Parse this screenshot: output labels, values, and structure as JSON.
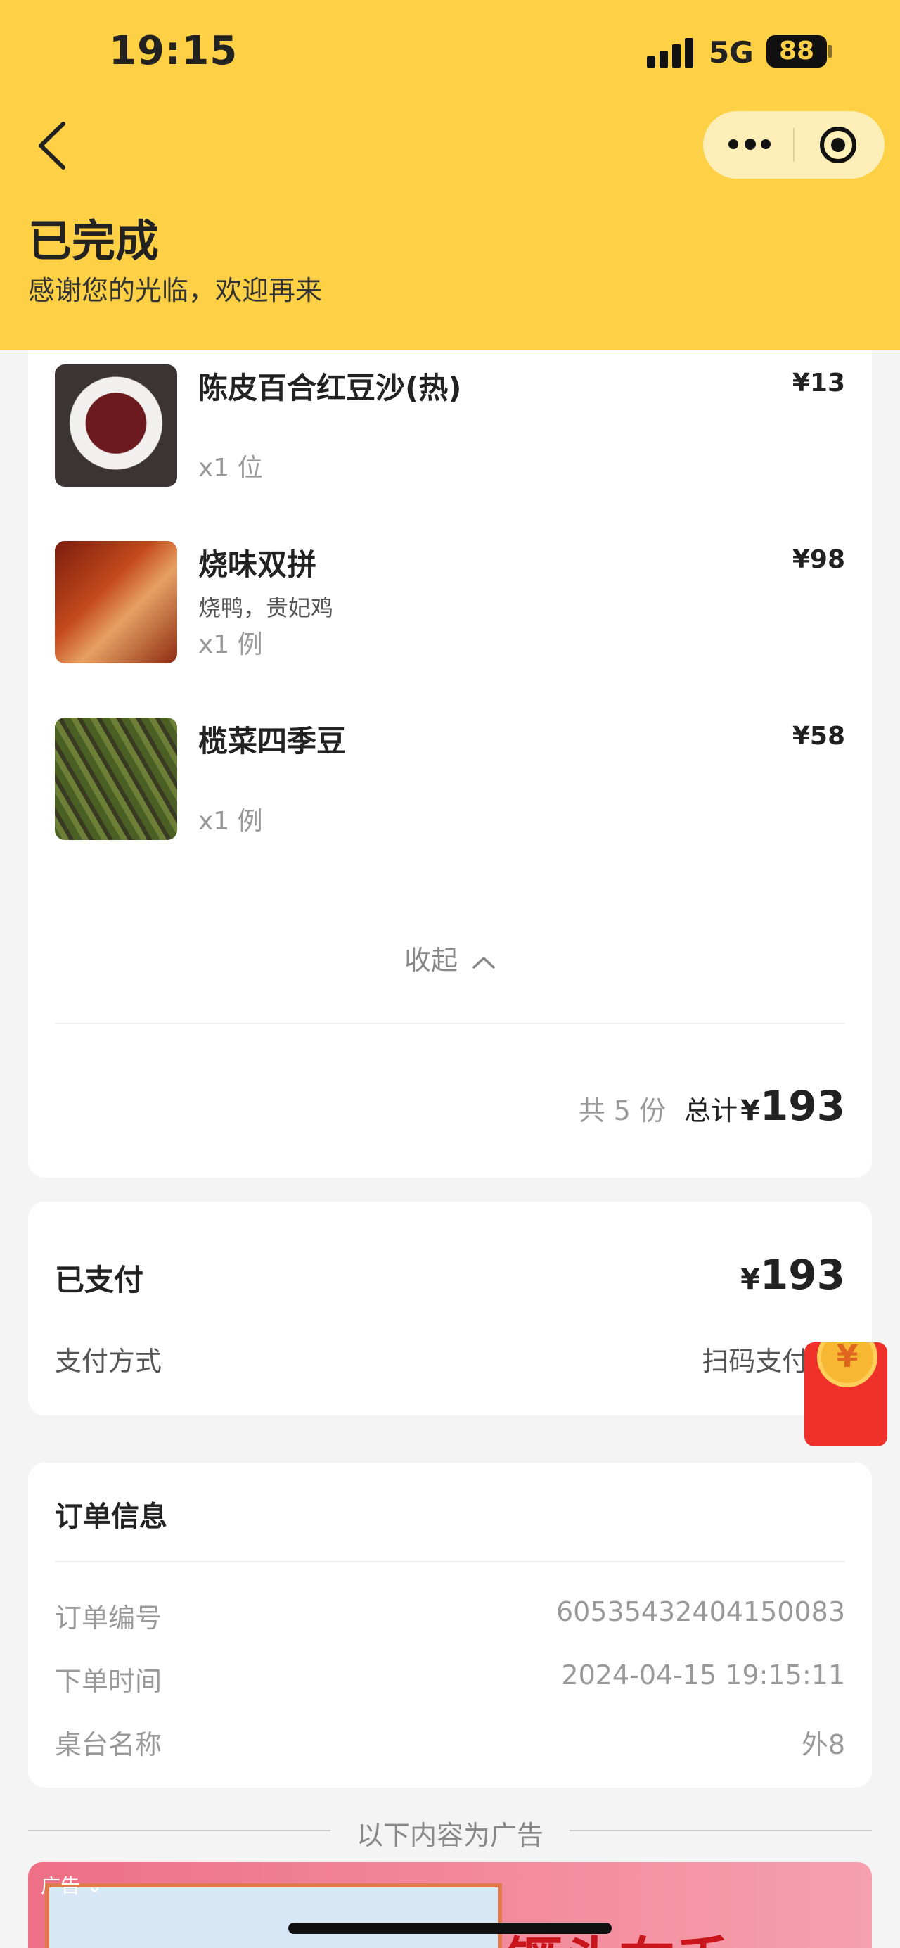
{
  "status_bar": {
    "time": "19:15",
    "network": "5G",
    "battery": "88"
  },
  "header": {
    "title": "已完成",
    "subtitle": "感谢您的光临，欢迎再来"
  },
  "order_items": [
    {
      "name": "陈皮百合红豆沙(热)",
      "desc": "",
      "qty": "x1 位",
      "price": "¥13"
    },
    {
      "name": "烧味双拼",
      "desc": "烧鸭，贵妃鸡",
      "qty": "x1 例",
      "price": "¥98"
    },
    {
      "name": "榄菜四季豆",
      "desc": "",
      "qty": "x1 例",
      "price": "¥58"
    }
  ],
  "collapse_label": "收起",
  "summary": {
    "count": "共 5 份",
    "total_label": "总计",
    "currency": "¥",
    "total": "193"
  },
  "payment": {
    "paid_label": "已支付",
    "currency": "¥",
    "amount": "193",
    "method_label": "支付方式",
    "method_value": "扫码支付-微"
  },
  "order_info": {
    "title": "订单信息",
    "rows": [
      {
        "label": "订单编号",
        "value": "60535432404150083"
      },
      {
        "label": "下单时间",
        "value": "2024-04-15 19:15:11"
      },
      {
        "label": "桌台名称",
        "value": "外8"
      }
    ]
  },
  "ads": {
    "divider_text": "以下内容为广告",
    "tag": "广告",
    "headline": "镢头在手"
  },
  "red_packet": {
    "symbol": "¥"
  }
}
